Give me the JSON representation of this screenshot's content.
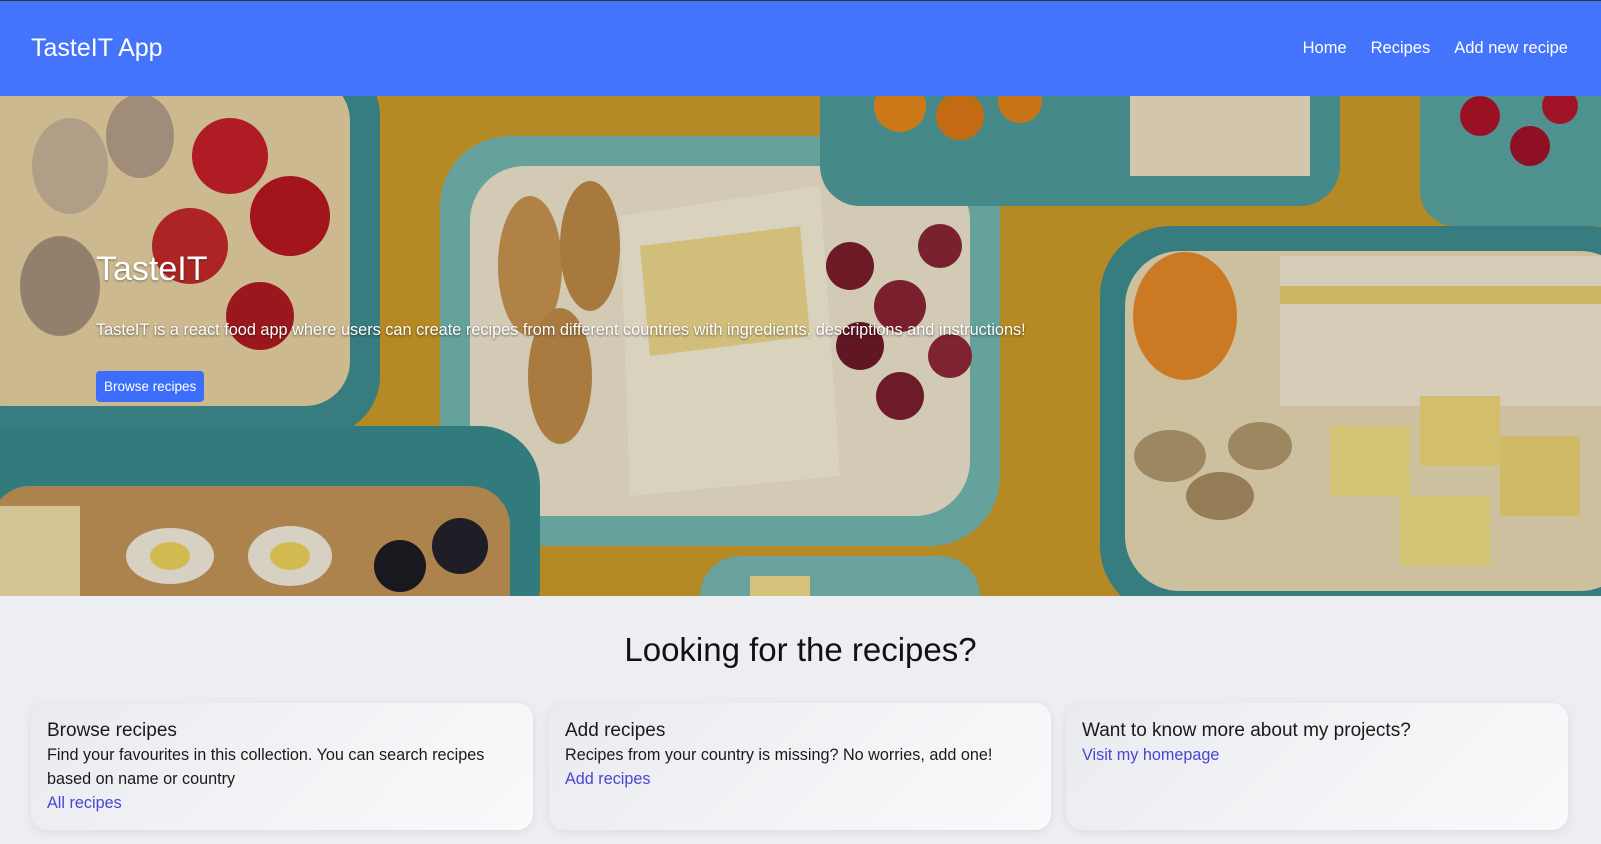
{
  "navbar": {
    "brand": "TasteIT App",
    "links": [
      "Home",
      "Recipes",
      "Add new recipe"
    ],
    "background": "#4574fc"
  },
  "hero": {
    "title": "TasteIT",
    "description": "TasteIT is a react food app where users can create recipes from different countries with ingredients, descriptions and instructions!",
    "button_label": "Browse recipes",
    "button_color": "#3d6efb"
  },
  "section": {
    "title": "Looking for the recipes?"
  },
  "cards": [
    {
      "title": "Browse recipes",
      "text": "Find your favourites in this collection. You can search recipes based on name or country",
      "link": "All recipes"
    },
    {
      "title": "Add recipes",
      "text": "Recipes from your country is missing? No worries, add one!",
      "link": "Add recipes"
    },
    {
      "title": "Want to know more about my projects?",
      "text": "",
      "link": "Visit my homepage"
    }
  ],
  "colors": {
    "page_background": "#eceef2",
    "link": "#4a45d6"
  }
}
